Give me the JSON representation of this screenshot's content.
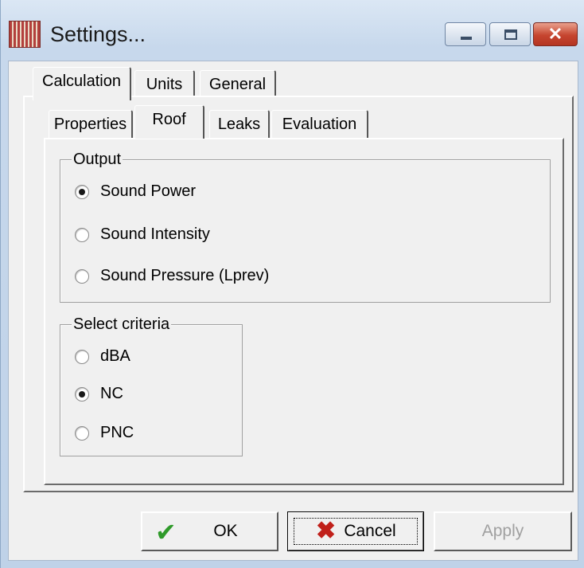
{
  "window": {
    "title": "Settings...",
    "icon": "app-icon",
    "controls": {
      "minimize_icon": "minimize-icon",
      "maximize_icon": "maximize-icon",
      "close_icon": "close-icon",
      "close_glyph": "✕"
    }
  },
  "tabs": [
    {
      "label": "Calculation",
      "active": true
    },
    {
      "label": "Units",
      "active": false
    },
    {
      "label": "General",
      "active": false
    }
  ],
  "subtabs": [
    {
      "label": "Properties",
      "active": false
    },
    {
      "label": "Roof",
      "active": true
    },
    {
      "label": "Leaks",
      "active": false
    },
    {
      "label": "Evaluation",
      "active": false
    }
  ],
  "output": {
    "label": "Output",
    "options": [
      {
        "label": "Sound Power",
        "checked": true
      },
      {
        "label": "Sound Intensity",
        "checked": false
      },
      {
        "label": "Sound Pressure (Lprev)",
        "checked": false
      }
    ]
  },
  "criteria": {
    "label": "Select criteria",
    "options": [
      {
        "label": "dBA",
        "checked": false
      },
      {
        "label": "NC",
        "checked": true
      },
      {
        "label": "PNC",
        "checked": false
      }
    ]
  },
  "buttons": {
    "ok": "OK",
    "cancel": "Cancel",
    "apply": "Apply",
    "ok_icon": "checkmark-icon",
    "cancel_icon": "x-icon",
    "apply_enabled": false
  },
  "colors": {
    "check": "#2f9a2a",
    "cancel_x": "#c0201a",
    "disabled_text": "#a0a0a0"
  }
}
